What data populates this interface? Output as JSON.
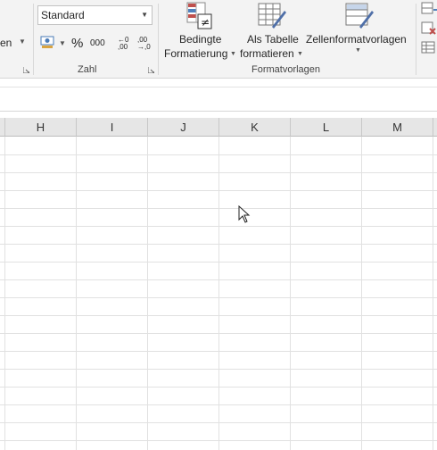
{
  "ribbon": {
    "alignment_group": {
      "partial_label": "en"
    },
    "number_group": {
      "label": "Zahl",
      "format_value": "Standard",
      "percent_symbol": "%",
      "thousands_symbol": "000",
      "increase_decimal": "←0 ,00",
      "decrease_decimal": ",00 →,0"
    },
    "styles_group": {
      "label": "Formatvorlagen",
      "conditional_line1": "Bedingte",
      "conditional_line2": "Formatierung",
      "table_line1": "Als Tabelle",
      "table_line2": "formatieren",
      "cell_styles": "Zellenformatvorlagen"
    }
  },
  "columns": [
    "H",
    "I",
    "J",
    "K",
    "L",
    "M"
  ]
}
